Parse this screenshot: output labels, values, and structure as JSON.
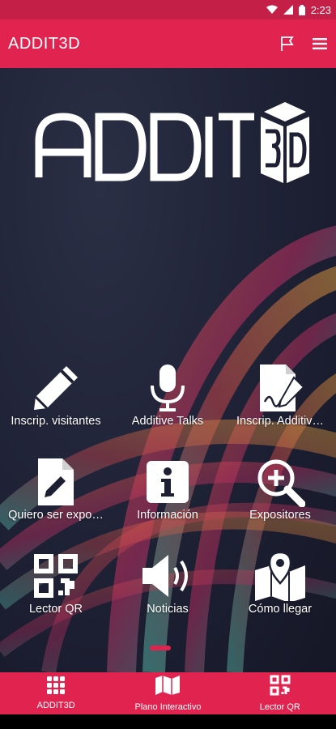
{
  "status_bar": {
    "time": "2:23"
  },
  "app_bar": {
    "title": "ADDIT3D",
    "flag_icon": "flag-icon",
    "menu_icon": "menu-icon"
  },
  "logo": {
    "text": "ADDIT3D"
  },
  "tiles": [
    {
      "label": "Inscrip. visitantes",
      "icon": "pencil-icon"
    },
    {
      "label": "Additive Talks",
      "icon": "microphone-icon"
    },
    {
      "label": "Inscrip. Additiv…",
      "icon": "document-signature-icon"
    },
    {
      "label": "Quiero ser expo…",
      "icon": "document-edit-icon"
    },
    {
      "label": "Información",
      "icon": "info-icon"
    },
    {
      "label": "Expositores",
      "icon": "zoom-in-icon"
    },
    {
      "label": "Lector QR",
      "icon": "qr-icon"
    },
    {
      "label": "Noticias",
      "icon": "speaker-icon"
    },
    {
      "label": "Cómo llegar",
      "icon": "map-pin-icon"
    }
  ],
  "bottom_nav": [
    {
      "label": "ADDIT3D",
      "icon": "grid-icon"
    },
    {
      "label": "Plano Interactivo",
      "icon": "map-icon"
    },
    {
      "label": "Lector QR",
      "icon": "qr-icon"
    }
  ],
  "colors": {
    "accent": "#e0244f",
    "status": "#c41f46",
    "background": "#1d2033"
  }
}
